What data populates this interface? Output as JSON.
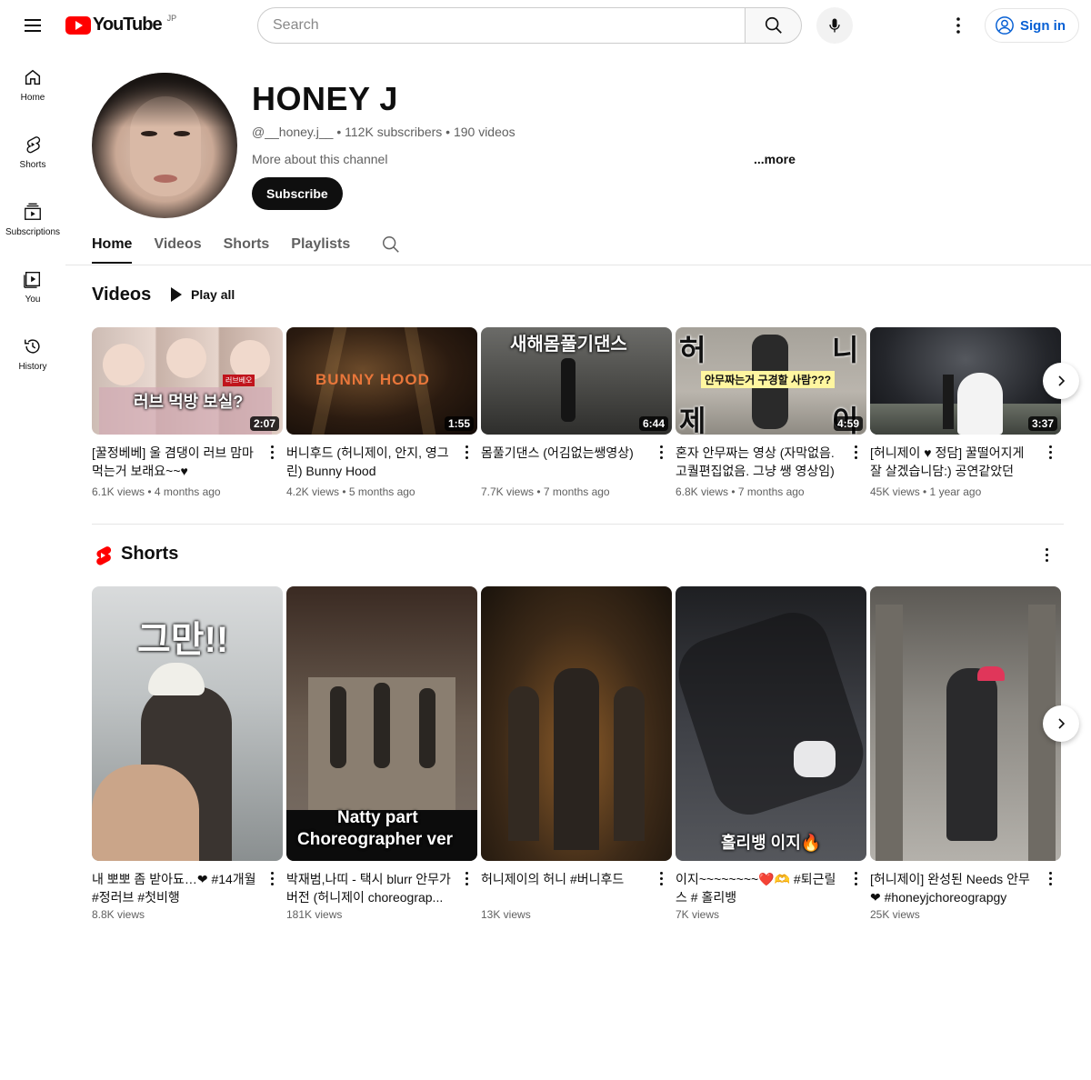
{
  "header": {
    "logo_text": "YouTube",
    "region": "JP",
    "search_placeholder": "Search",
    "signin_label": "Sign in"
  },
  "sidenav": [
    {
      "label": "Home",
      "icon": "home-icon"
    },
    {
      "label": "Shorts",
      "icon": "shorts-icon"
    },
    {
      "label": "Subscriptions",
      "icon": "subscriptions-icon"
    },
    {
      "label": "You",
      "icon": "you-icon"
    },
    {
      "label": "History",
      "icon": "history-icon"
    }
  ],
  "channel": {
    "name": "HONEY J",
    "meta": "@__honey.j__ • 112K subscribers • 190 videos",
    "about": "More about this channel",
    "more": "...more",
    "subscribe_label": "Subscribe"
  },
  "tabs": [
    "Home",
    "Videos",
    "Shorts",
    "Playlists"
  ],
  "videos_section": {
    "title": "Videos",
    "play_all": "Play all",
    "items": [
      {
        "title": "[꿀정베베] 울 겸댕이 러브 맘마 먹는거 보래요~~♥",
        "meta": "6.1K views • 4 months ago",
        "duration": "2:07",
        "overlay": "러브 먹방 보실?",
        "badge": "러브베오"
      },
      {
        "title": "버니후드 (허니제이, 안지, 영그 린) Bunny Hood",
        "meta": "4.2K views • 5 months ago",
        "duration": "1:55",
        "overlay": "BUNNY HOOD"
      },
      {
        "title": "몸풀기댄스 (어김없는쌩영상)",
        "meta": "7.7K views • 7 months ago",
        "duration": "6:44",
        "overlay": "새해몸풀기댄스"
      },
      {
        "title": "혼자 안무짜는 영상 (자막없음. 고퀄편집없음. 그냥 쌩 영상임)",
        "meta": "6.8K views • 7 months ago",
        "duration": "4:59",
        "overlay": "안무짜는거 구경할 사람???",
        "chars": [
          "허",
          "니",
          "제",
          "이"
        ]
      },
      {
        "title": "[허니제이 ♥ 정담] 꿀떨어지게 잘 살겠습니담:) 공연같았던 결...",
        "meta": "45K views • 1 year ago",
        "duration": "3:37"
      }
    ]
  },
  "shorts_section": {
    "title": "Shorts",
    "items": [
      {
        "title": "내 뽀뽀 좀 받아됴…❤ #14개월 #정러브 #첫비행",
        "meta": "8.8K views",
        "overlay": "그만!!"
      },
      {
        "title": "박재범,나띠 - 택시 blurr 안무가 버전 (허니제이 choreograp...",
        "meta": "181K views",
        "overlay": "Natty part",
        "overlay2": "Choreographer ver"
      },
      {
        "title": "허니제이의 허니 #버니후드",
        "meta": "13K views"
      },
      {
        "title": "이지~~~~~~~~❤️🫶 #퇴근릴스 # 홀리뱅",
        "meta": "7K views",
        "overlay": "홀리뱅 이지🔥"
      },
      {
        "title": "[허니제이] 완성된 Needs 안무 ❤ #honeyjchoreograpgy",
        "meta": "25K views"
      }
    ]
  },
  "colors": {
    "brand_red": "#ff0000",
    "link_blue": "#065fd4",
    "text_primary": "#0f0f0f",
    "text_secondary": "#606060"
  }
}
